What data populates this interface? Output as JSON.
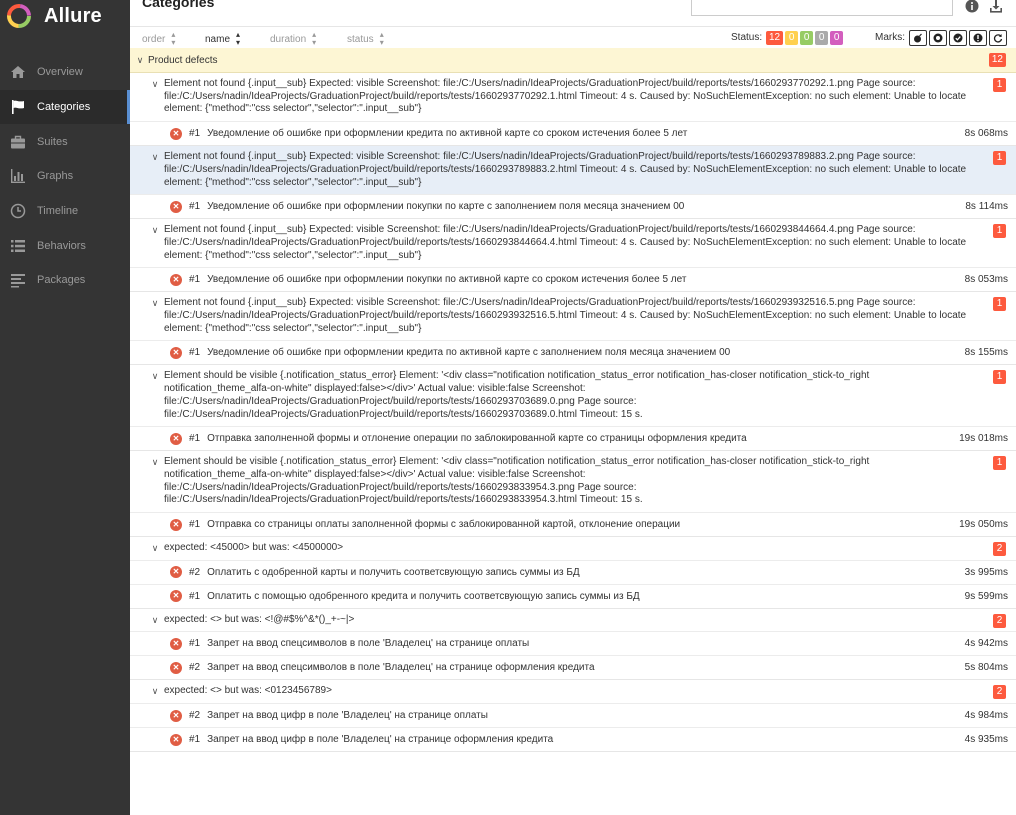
{
  "app": {
    "name": "Allure",
    "title": "Categories"
  },
  "colors": {
    "failed": "#fd5a3e",
    "broken": "#ffd050",
    "passed": "#97cc64",
    "skipped": "#aaaaaa",
    "unknown": "#d35ebe",
    "accent": "#5a8fd2",
    "sidebar": "#343434"
  },
  "sidebar": {
    "items": [
      {
        "label": "Overview",
        "icon": "home-icon",
        "active": false
      },
      {
        "label": "Categories",
        "icon": "flag-icon",
        "active": true
      },
      {
        "label": "Suites",
        "icon": "briefcase-icon",
        "active": false
      },
      {
        "label": "Graphs",
        "icon": "bar-chart-icon",
        "active": false
      },
      {
        "label": "Timeline",
        "icon": "clock-icon",
        "active": false
      },
      {
        "label": "Behaviors",
        "icon": "list-icon",
        "active": false
      },
      {
        "label": "Packages",
        "icon": "align-left-icon",
        "active": false
      }
    ]
  },
  "toolbar": {
    "sort": [
      "order",
      "name",
      "duration",
      "status"
    ],
    "status_label": "Status:",
    "status_counts": [
      "12",
      "0",
      "0",
      "0",
      "0"
    ],
    "marks_label": "Marks:"
  },
  "group": {
    "name": "Product defects",
    "count": "12"
  },
  "categories": [
    {
      "message": "Element not found {.input__sub} Expected: visible Screenshot: file:/C:/Users/nadin/IdeaProjects/GraduationProject/build/reports/tests/1660293770292.1.png Page source: file:/C:/Users/nadin/IdeaProjects/GraduationProject/build/reports/tests/1660293770292.1.html Timeout: 4 s. Caused by: NoSuchElementException: no such element: Unable to locate element: {\"method\":\"css selector\",\"selector\":\".input__sub\"}",
      "count": "1",
      "tests": [
        {
          "num": "#1",
          "name": "Уведомление об ошибке при оформлении кредита по активной карте со сроком истечения более 5 лет",
          "duration": "8s 068ms"
        }
      ]
    },
    {
      "message": "Element not found {.input__sub} Expected: visible Screenshot: file:/C:/Users/nadin/IdeaProjects/GraduationProject/build/reports/tests/1660293789883.2.png Page source: file:/C:/Users/nadin/IdeaProjects/GraduationProject/build/reports/tests/1660293789883.2.html Timeout: 4 s. Caused by: NoSuchElementException: no such element: Unable to locate element: {\"method\":\"css selector\",\"selector\":\".input__sub\"}",
      "count": "1",
      "tests": [
        {
          "num": "#1",
          "name": "Уведомление об ошибке при оформлении покупки по карте с заполнением поля месяца значением 00",
          "duration": "8s 114ms"
        }
      ]
    },
    {
      "message": "Element not found {.input__sub} Expected: visible Screenshot: file:/C:/Users/nadin/IdeaProjects/GraduationProject/build/reports/tests/1660293844664.4.png Page source: file:/C:/Users/nadin/IdeaProjects/GraduationProject/build/reports/tests/1660293844664.4.html Timeout: 4 s. Caused by: NoSuchElementException: no such element: Unable to locate element: {\"method\":\"css selector\",\"selector\":\".input__sub\"}",
      "count": "1",
      "tests": [
        {
          "num": "#1",
          "name": "Уведомление об ошибке при оформлении покупки по активной карте со сроком истечения более 5 лет",
          "duration": "8s 053ms"
        }
      ]
    },
    {
      "message": "Element not found {.input__sub} Expected: visible Screenshot: file:/C:/Users/nadin/IdeaProjects/GraduationProject/build/reports/tests/1660293932516.5.png Page source: file:/C:/Users/nadin/IdeaProjects/GraduationProject/build/reports/tests/1660293932516.5.html Timeout: 4 s. Caused by: NoSuchElementException: no such element: Unable to locate element: {\"method\":\"css selector\",\"selector\":\".input__sub\"}",
      "count": "1",
      "tests": [
        {
          "num": "#1",
          "name": "Уведомление об ошибке при оформлении кредита по активной карте с заполнением поля месяца значением 00",
          "duration": "8s 155ms"
        }
      ]
    },
    {
      "message": "Element should be visible {.notification_status_error} Element: '<div class=\"notification notification_status_error notification_has-closer notification_stick-to_right notification_theme_alfa-on-white\" displayed:false></div>' Actual value: visible:false Screenshot: file:/C:/Users/nadin/IdeaProjects/GraduationProject/build/reports/tests/1660293703689.0.png Page source: file:/C:/Users/nadin/IdeaProjects/GraduationProject/build/reports/tests/1660293703689.0.html Timeout: 15 s.",
      "count": "1",
      "tests": [
        {
          "num": "#1",
          "name": "Отправка заполненной формы и отлонение операции по заблокированной карте со страницы оформления кредита",
          "duration": "19s 018ms"
        }
      ]
    },
    {
      "message": "Element should be visible {.notification_status_error} Element: '<div class=\"notification notification_status_error notification_has-closer notification_stick-to_right notification_theme_alfa-on-white\" displayed:false></div>' Actual value: visible:false Screenshot: file:/C:/Users/nadin/IdeaProjects/GraduationProject/build/reports/tests/1660293833954.3.png Page source: file:/C:/Users/nadin/IdeaProjects/GraduationProject/build/reports/tests/1660293833954.3.html Timeout: 15 s.",
      "count": "1",
      "tests": [
        {
          "num": "#1",
          "name": "Отправка со страницы оплаты заполненной формы с заблокированной картой, отклонение операции",
          "duration": "19s 050ms"
        }
      ]
    },
    {
      "message": "expected: <45000> but was: <4500000>",
      "count": "2",
      "tests": [
        {
          "num": "#2",
          "name": "Оплатить с одобренной карты и получить соответсвующую запись суммы из БД",
          "duration": "3s 995ms"
        },
        {
          "num": "#1",
          "name": "Оплатить с помощью одобренного кредита и получить соответсвующую запись суммы из БД",
          "duration": "9s 599ms"
        }
      ]
    },
    {
      "message": "expected: <> but was: <!@#$%^&*()_+-~|>",
      "count": "2",
      "tests": [
        {
          "num": "#1",
          "name": "Запрет на ввод спецсимволов в поле 'Владелец' на странице оплаты",
          "duration": "4s 942ms"
        },
        {
          "num": "#2",
          "name": "Запрет на ввод спецсимволов в поле 'Владелец' на странице оформления кредита",
          "duration": "5s 804ms"
        }
      ]
    },
    {
      "message": "expected: <> but was: <0123456789>",
      "count": "2",
      "tests": [
        {
          "num": "#2",
          "name": "Запрет на ввод цифр в поле 'Владелец' на странице оплаты",
          "duration": "4s 984ms"
        },
        {
          "num": "#1",
          "name": "Запрет на ввод цифр в поле 'Владелец' на странице оформления кредита",
          "duration": "4s 935ms"
        }
      ]
    }
  ]
}
